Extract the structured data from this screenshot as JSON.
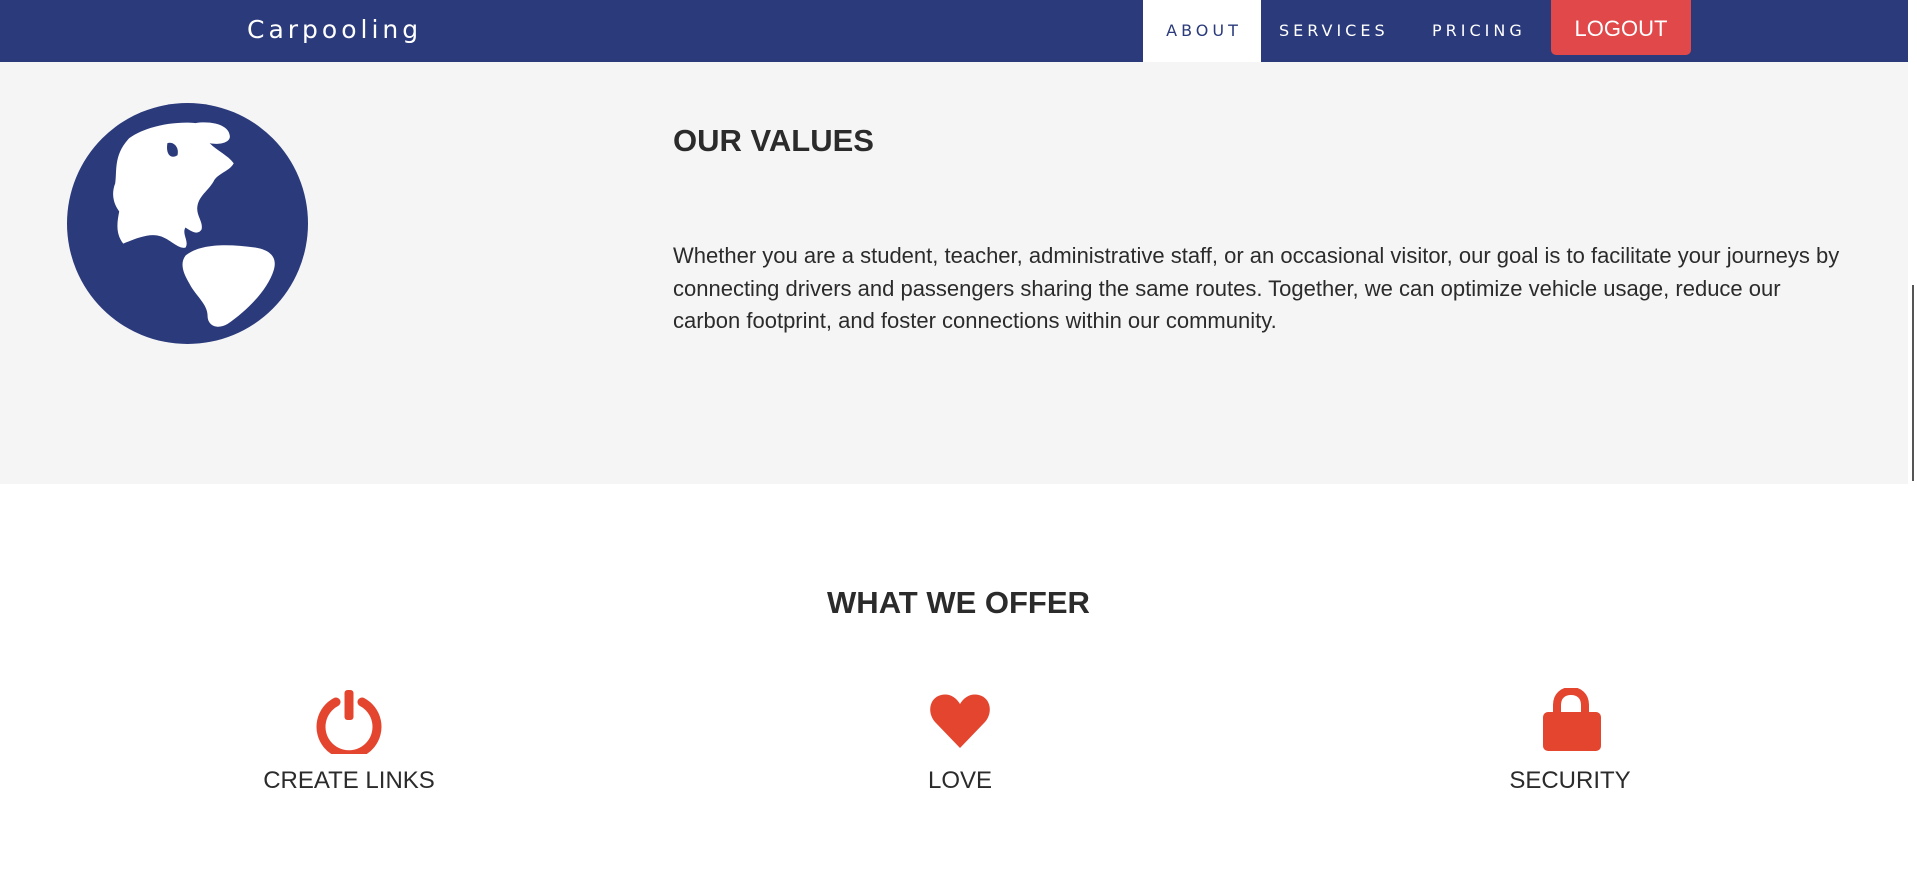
{
  "navbar": {
    "brand": "Carpooling",
    "links": [
      {
        "label": "ABOUT",
        "active": true
      },
      {
        "label": "SERVICES",
        "active": false
      },
      {
        "label": "PRICING",
        "active": false
      }
    ],
    "logout_label": "LOGOUT"
  },
  "values_section": {
    "icon": "globe-icon",
    "title": "OUR VALUES",
    "text": "Whether you are a student, teacher, administrative staff, or an occasional visitor, our goal is to facilitate your journeys by connecting drivers and passengers sharing the same routes. Together, we can optimize vehicle usage, reduce our carbon footprint, and foster connections within our community."
  },
  "offer_section": {
    "title": "WHAT WE OFFER",
    "features": [
      {
        "icon": "power-icon",
        "label": "CREATE LINKS"
      },
      {
        "icon": "heart-icon",
        "label": "LOVE"
      },
      {
        "icon": "lock-icon",
        "label": "SECURITY"
      }
    ]
  },
  "colors": {
    "navbar": "#2a3a7b",
    "accent": "#e0484a",
    "icon_red": "#e4452f",
    "section_bg": "#f5f5f5"
  }
}
